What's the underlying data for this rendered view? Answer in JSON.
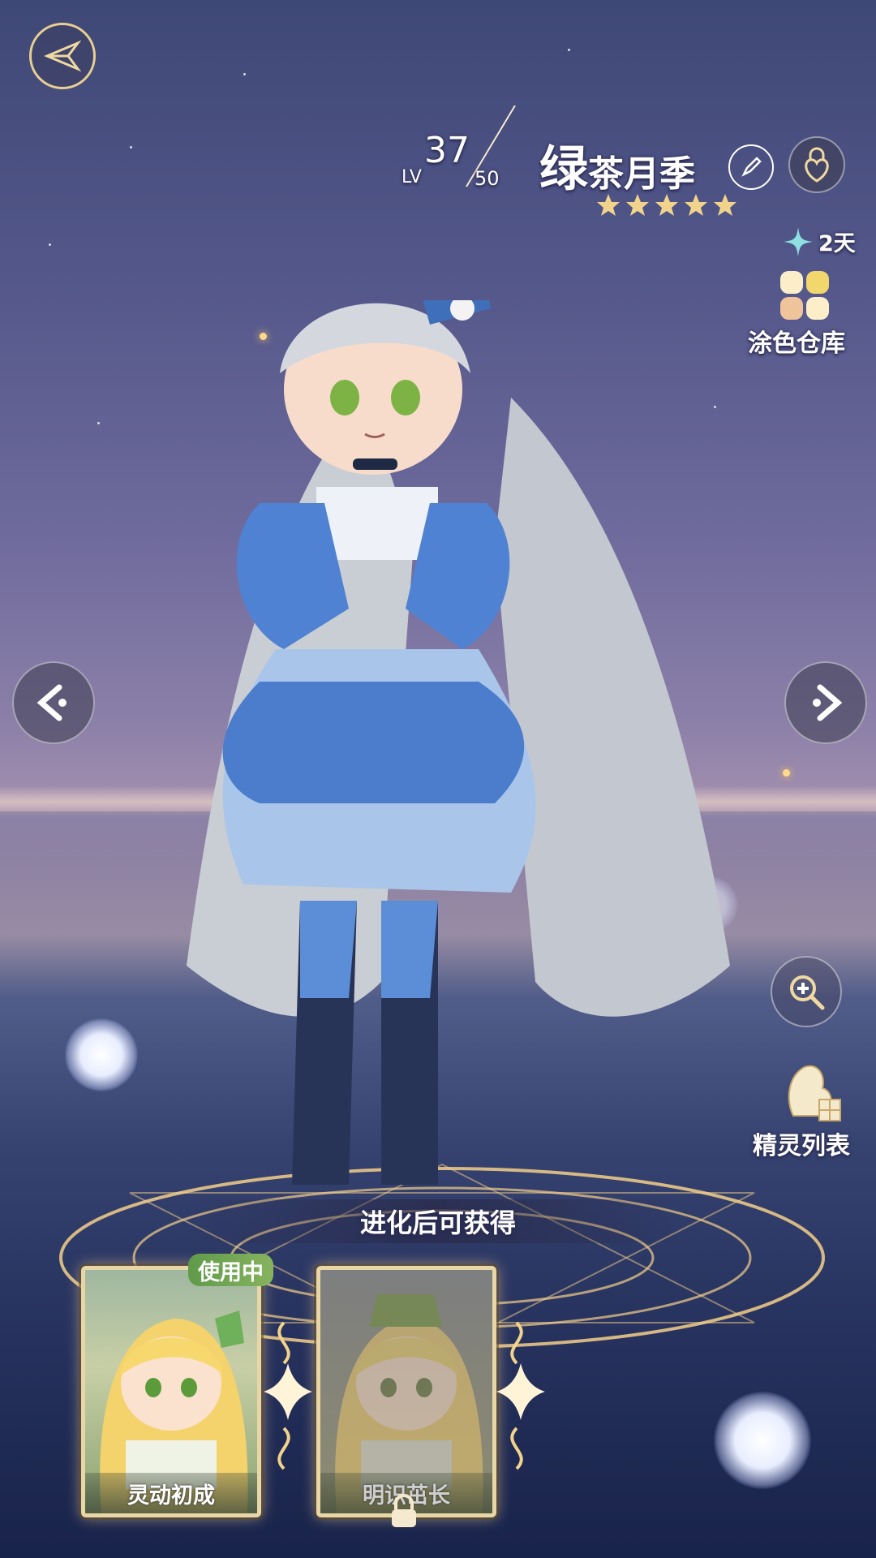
{
  "level": {
    "prefix": "LV",
    "current": "37",
    "max": "50"
  },
  "pet": {
    "name_first": "绿",
    "name_rest": "茶月季",
    "stars": 5
  },
  "timer": {
    "label": "2天"
  },
  "side_menu": {
    "coloring_warehouse": "涂色仓库",
    "sprite_list": "精灵列表"
  },
  "evolution": {
    "banner": "进化后可获得"
  },
  "forms": [
    {
      "name": "灵动初成",
      "status": "使用中",
      "locked": false
    },
    {
      "name": "明识茁长",
      "status": "",
      "locked": true
    }
  ],
  "colors": {
    "gold": "#e8d6a6",
    "accent_green": "#5f9a4a",
    "sky": "#54578a"
  },
  "icons": {
    "back": "feather-back-icon",
    "edit": "pencil-icon",
    "lock": "heart-lock-icon",
    "timer": "four-point-star-icon",
    "palette": "color-grid-icon",
    "prev": "chevron-left-icon",
    "next": "chevron-right-icon",
    "zoom": "zoom-in-icon",
    "sprite_list": "sprite-list-icon"
  }
}
